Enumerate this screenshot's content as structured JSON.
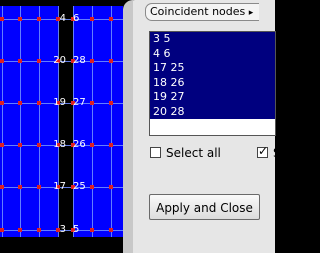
{
  "mesh": {
    "label_rows": [
      {
        "left": "4",
        "right": "6"
      },
      {
        "left": "20",
        "right": "28"
      },
      {
        "left": "19",
        "right": "27"
      },
      {
        "left": "18",
        "right": "26"
      },
      {
        "left": "17",
        "right": "25"
      },
      {
        "left": "3",
        "right": "5"
      }
    ],
    "colors": {
      "fill": "#0000ff",
      "background": "#000000",
      "node": "#e02020"
    }
  },
  "panel": {
    "tab_label": "Coincident nodes",
    "tab_icon": "chevron-right-icon",
    "pairs": [
      "3 5",
      "4 6",
      "17 25",
      "18 26",
      "19 27",
      "20 28"
    ],
    "select_all_label": "Select all",
    "select_all_checked": false,
    "second_checkbox_label": "S",
    "second_checkbox_checked": true,
    "apply_label": "Apply and Close"
  }
}
